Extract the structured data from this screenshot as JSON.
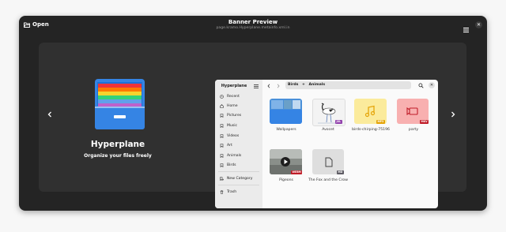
{
  "headerbar": {
    "open_label": "Open",
    "title": "Banner Preview",
    "subtitle": "page.kramo.Hyperplane.metainfo.xml.in"
  },
  "banner": {
    "app_name": "Hyperplane",
    "summary": "Organize your files freely",
    "prev_icon": "chevron-left-icon",
    "next_icon": "chevron-right-icon",
    "background": "#303030"
  },
  "screenshot": {
    "sidebar": {
      "title": "Hyperplane",
      "items": [
        {
          "label": "Recent",
          "icon": "clock-icon"
        },
        {
          "label": "Home",
          "icon": "home-icon"
        },
        {
          "label": "Pictures",
          "icon": "tag-icon"
        },
        {
          "label": "Music",
          "icon": "tag-icon"
        },
        {
          "label": "Videos",
          "icon": "tag-icon"
        },
        {
          "label": "Art",
          "icon": "tag-icon"
        },
        {
          "label": "Animals",
          "icon": "tag-icon"
        },
        {
          "label": "Birds",
          "icon": "tag-icon"
        },
        {
          "label": "New Category",
          "icon": "tag-add-icon"
        },
        {
          "label": "Trash",
          "icon": "trash-icon"
        }
      ]
    },
    "path": [
      "Birds",
      "+",
      "Animals"
    ],
    "items": [
      {
        "label": "Wallpapers",
        "kind": "folder",
        "badge": ""
      },
      {
        "label": "Avocet",
        "kind": "image",
        "badge": "JXL"
      },
      {
        "label": "birds-chirping-75196",
        "kind": "audio",
        "badge": "MP3"
      },
      {
        "label": "party",
        "kind": "video",
        "badge": "MKV"
      },
      {
        "label": "Pigeons",
        "kind": "video-thumb",
        "badge": "WEBM"
      },
      {
        "label": "The Fox and the Crow",
        "kind": "document",
        "badge": "MD"
      }
    ]
  },
  "colors": {
    "accent_folder": "#4a90d9",
    "audio_tile": "#fbeb9c",
    "audio_badge": "#e5a50a",
    "video_tile": "#f8b0b0",
    "video_badge": "#c01c28",
    "image_badge": "#9141ac",
    "document_badge": "#5e5c64"
  }
}
